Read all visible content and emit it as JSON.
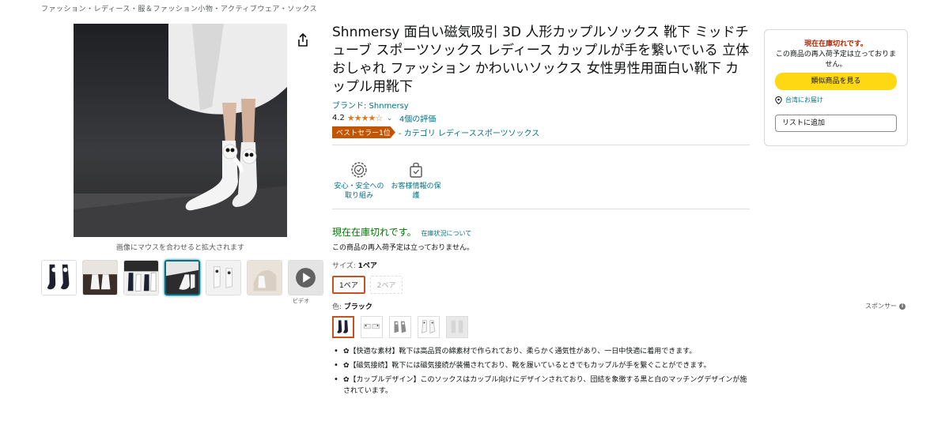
{
  "breadcrumb": "ファッション・レディース・服＆ファッション小物・アクティブウェア・ソックス",
  "gallery": {
    "zoom_hint": "画像にマウスを合わせると拡大されます",
    "video_label": "ビデオ"
  },
  "product": {
    "title": "Shnmersy 面白い磁気吸引 3D 人形カップルソックス 靴下 ミッドチューブ スポーツソックス レディース カップルが手を繋いでいる 立体 おしゃれ ファッション かわいいソックス 女性男性用面白い靴下 カップル用靴下",
    "brand": "ブランド: Shnmersy",
    "rating_value": "4.2",
    "stars": "★★★★☆",
    "rating_count": "4個の評価",
    "bestseller_badge": "ベストセラー1位",
    "bestseller_category": "- カテゴリ レディーススポーツソックス"
  },
  "trust": [
    {
      "label": "安心・安全への取り組み",
      "icon": "shield-badge-icon"
    },
    {
      "label": "お客様情報の保護",
      "icon": "secure-bag-icon"
    }
  ],
  "availability": {
    "status": "現在在庫切れです。",
    "link": "在庫状況について",
    "restock": "この商品の再入荷予定は立っておりません。"
  },
  "size": {
    "label": "サイズ:",
    "selected": "1ペア",
    "options": [
      "1ペア",
      "2ペア"
    ]
  },
  "color": {
    "label": "色:",
    "selected": "ブラック"
  },
  "bullets": [
    "✿【快適な素材】靴下は高品質の綿素材で作られており、柔らかく通気性があり、一日中快適に着用できます。",
    "✿【磁気接続】靴下には磁気接続が装備されており、靴を履いているときでもカップルが手を繋ぐことができます。",
    "✿【カップルデザイン】このソックスはカップル向けにデザインされており、団結を象徴する黒と白のマッチングデザインが施されています。"
  ],
  "buybox": {
    "status": "現在在庫切れです。",
    "restock": "この商品の再入荷予定は立っておりません。",
    "similar_button": "類似商品を見る",
    "deliver_to": "台湾にお届け",
    "add_to_list": "リストに追加"
  },
  "sponsor": "スポンサー",
  "colors": {
    "link": "#007185",
    "accent": "#c45500",
    "in_stock": "#007600",
    "button": "#ffd814"
  }
}
